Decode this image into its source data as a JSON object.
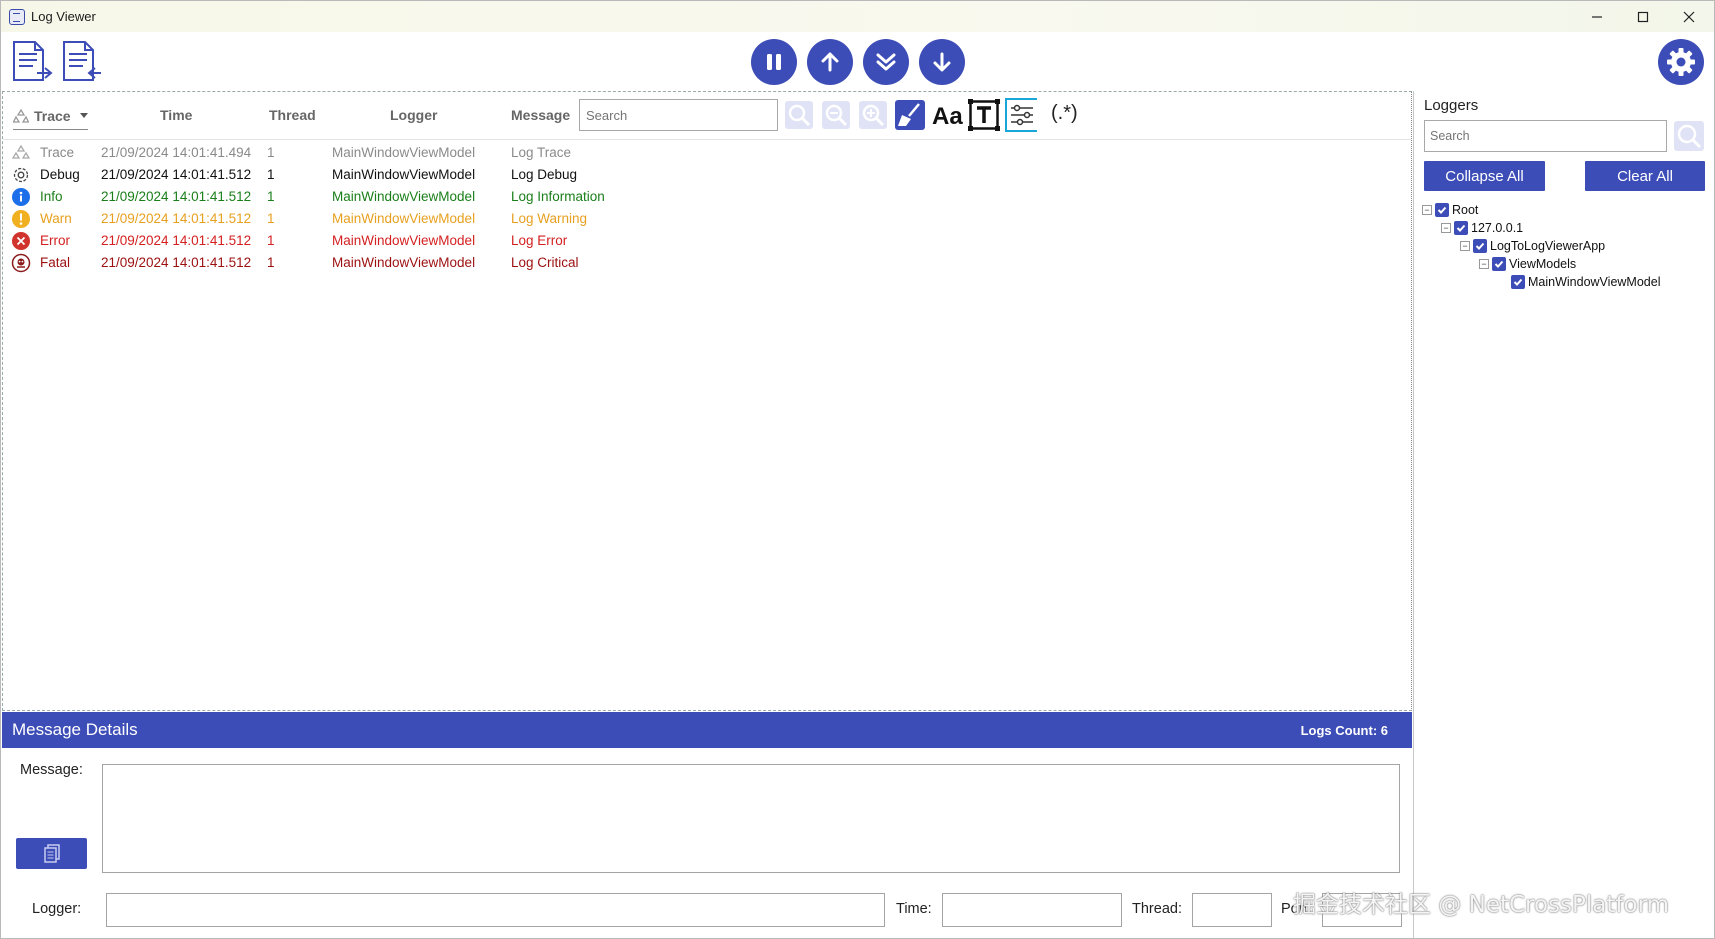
{
  "window": {
    "title": "Log Viewer"
  },
  "toolbar": {
    "open_file_icon": "document-import-icon",
    "open_file2_icon": "document-export-icon",
    "pause_icon": "pause-icon",
    "scroll_up_icon": "arrow-up-icon",
    "scroll_bottom_icon": "double-chevron-down-icon",
    "scroll_down_icon": "arrow-down-icon",
    "settings_icon": "gear-icon"
  },
  "log_table": {
    "level_filter": "Trace",
    "columns": {
      "time": "Time",
      "thread": "Thread",
      "logger": "Logger",
      "message": "Message"
    },
    "search_placeholder": "Search",
    "regex_label": "(.*)",
    "rows": [
      {
        "level": "Trace",
        "time": "21/09/2024 14:01:41.494",
        "thread": "1",
        "logger": "MainWindowViewModel",
        "message": "Log Trace",
        "color": "#8a8a8a",
        "icon": "trace-icon"
      },
      {
        "level": "Debug",
        "time": "21/09/2024 14:01:41.512",
        "thread": "1",
        "logger": "MainWindowViewModel",
        "message": "Log Debug",
        "color": "#111111",
        "icon": "debug-gear-icon"
      },
      {
        "level": "Info",
        "time": "21/09/2024 14:01:41.512",
        "thread": "1",
        "logger": "MainWindowViewModel",
        "message": "Log Information",
        "color": "#1a7f1a",
        "icon": "info-icon"
      },
      {
        "level": "Warn",
        "time": "21/09/2024 14:01:41.512",
        "thread": "1",
        "logger": "MainWindowViewModel",
        "message": "Log Warning",
        "color": "#e8a020",
        "icon": "warning-icon"
      },
      {
        "level": "Error",
        "time": "21/09/2024 14:01:41.512",
        "thread": "1",
        "logger": "MainWindowViewModel",
        "message": "Log Error",
        "color": "#d42020",
        "icon": "error-icon"
      },
      {
        "level": "Fatal",
        "time": "21/09/2024 14:01:41.512",
        "thread": "1",
        "logger": "MainWindowViewModel",
        "message": "Log Critical",
        "color": "#9c1010",
        "icon": "fatal-icon"
      }
    ]
  },
  "details": {
    "title": "Message Details",
    "logs_count": "Logs Count: 6",
    "message_label": "Message:",
    "logger_label": "Logger:",
    "time_label": "Time:",
    "thread_label": "Thread:",
    "port_label": "Port:"
  },
  "loggers": {
    "title": "Loggers",
    "search_placeholder": "Search",
    "collapse_all": "Collapse All",
    "clear_all": "Clear All",
    "tree": [
      "Root",
      "127.0.0.1",
      "LogToLogViewerApp",
      "ViewModels",
      "MainWindowViewModel"
    ]
  },
  "watermark": "掘金技术社区 @ NetCrossPlatform",
  "colors": {
    "accent": "#3d4db7"
  }
}
